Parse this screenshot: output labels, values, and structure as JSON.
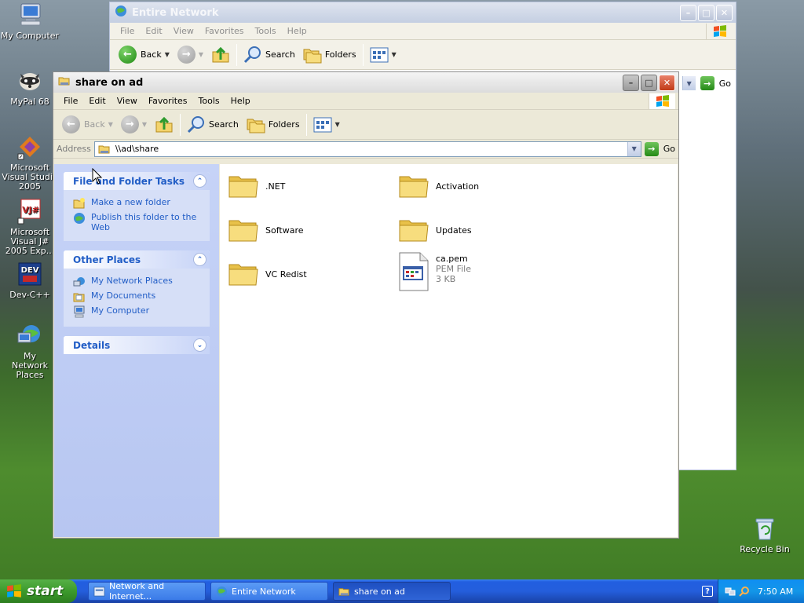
{
  "desktop": {
    "icons": [
      {
        "label": "My Computer"
      },
      {
        "label": "MyPal 68"
      },
      {
        "label": "Microsoft Visual Studio 2005"
      },
      {
        "label": "Microsoft Visual J# 2005 Exp..."
      },
      {
        "label": "Dev-C++"
      },
      {
        "label": "My Network Places"
      },
      {
        "label": "Recycle Bin"
      }
    ]
  },
  "back_window": {
    "title": "Entire Network",
    "menu": [
      "File",
      "Edit",
      "View",
      "Favorites",
      "Tools",
      "Help"
    ],
    "toolbar": {
      "back": "Back",
      "search": "Search",
      "folders": "Folders"
    },
    "go": "Go"
  },
  "front_window": {
    "title": "share on ad",
    "menu": [
      "File",
      "Edit",
      "View",
      "Favorites",
      "Tools",
      "Help"
    ],
    "toolbar": {
      "back": "Back",
      "search": "Search",
      "folders": "Folders"
    },
    "address": {
      "label": "Address",
      "value": "\\\\ad\\share",
      "go": "Go"
    },
    "taskpane": {
      "file_tasks": {
        "title": "File and Folder Tasks",
        "links": [
          "Make a new folder",
          "Publish this folder to the Web"
        ]
      },
      "other_places": {
        "title": "Other Places",
        "links": [
          "My Network Places",
          "My Documents",
          "My Computer"
        ]
      },
      "details": {
        "title": "Details"
      }
    },
    "files": [
      {
        "name": ".NET"
      },
      {
        "name": "Activation"
      },
      {
        "name": "Software"
      },
      {
        "name": "Updates"
      },
      {
        "name": "VC Redist"
      },
      {
        "name": "ca.pem",
        "type": "PEM File",
        "size": "3 KB"
      }
    ]
  },
  "taskbar": {
    "start": "start",
    "tasks": [
      "Network and Internet...",
      "Entire Network",
      "share on ad"
    ],
    "clock": "7:50 AM"
  }
}
